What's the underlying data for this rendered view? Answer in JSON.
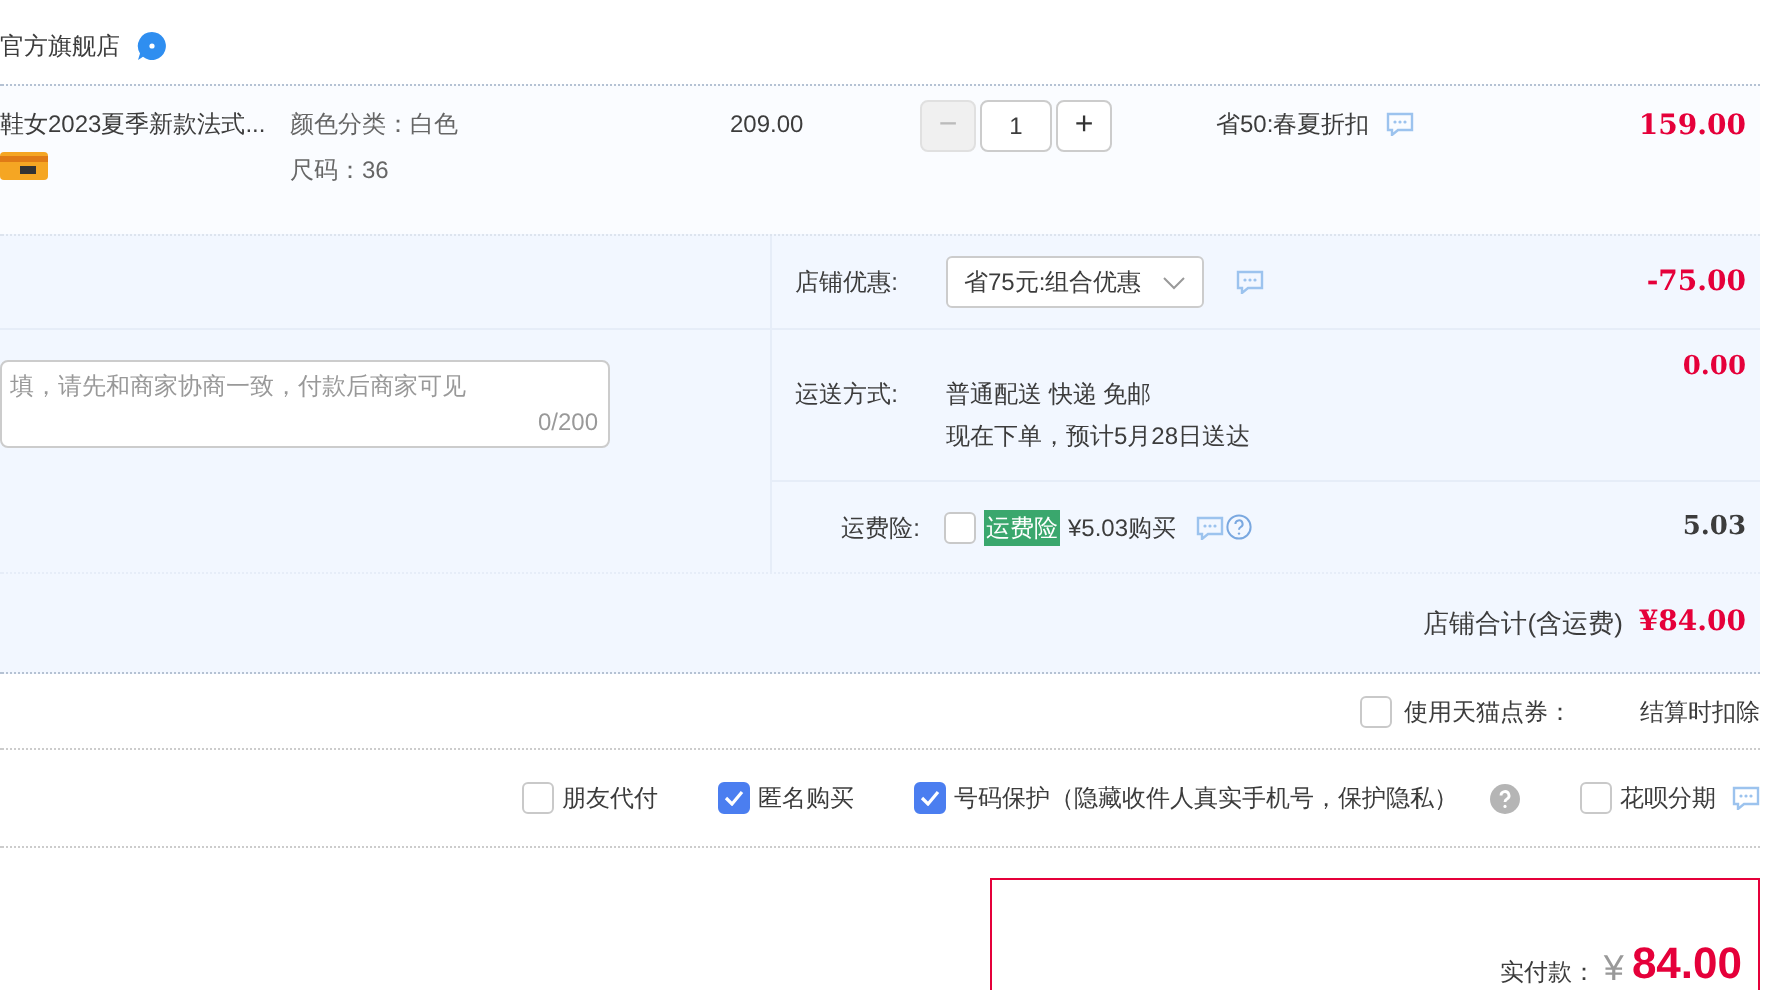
{
  "shop": {
    "name": "官方旗舰店"
  },
  "item": {
    "title": "鞋女2023夏季新款法式...",
    "specs": [
      "颜色分类：白色",
      "尺码：36"
    ],
    "price": "209.00",
    "quantity": "1",
    "minus": "−",
    "plus": "+",
    "minus_disabled": true,
    "promo": "省50:春夏折扣",
    "subtotal": "159.00"
  },
  "message": {
    "placeholder": "填，请先和商家协商一致，付款后商家可见",
    "counter": "0/200"
  },
  "shop_discount": {
    "label": "店铺优惠:",
    "select": "省75元:组合优惠",
    "amount": "-75.00"
  },
  "shipping": {
    "label": "运送方式:",
    "lines": [
      "普通配送 快递 免邮",
      "现在下单，预计5月28日送达"
    ],
    "amount": "0.00"
  },
  "insurance": {
    "label": "运费险:",
    "checked": false,
    "tag": "运费险",
    "text": "¥5.03购买",
    "amount": "5.03"
  },
  "shop_total": {
    "label": "店铺合计(含运费)",
    "amount": "¥84.00"
  },
  "coupon": {
    "label": "使用天猫点券：",
    "checked": false,
    "note": "结算时扣除"
  },
  "options": [
    {
      "label": "朋友代付",
      "checked": false,
      "kind": "plain"
    },
    {
      "label": "匿名购买",
      "checked": true,
      "kind": "plain"
    },
    {
      "label": "号码保护（隐藏收件人真实手机号，保护隐私）",
      "checked": true,
      "kind": "help"
    },
    {
      "label": "花呗分期",
      "checked": false,
      "kind": "chat"
    }
  ],
  "payment": {
    "label": "实付款：",
    "currency": "¥",
    "amount": "84.00"
  }
}
